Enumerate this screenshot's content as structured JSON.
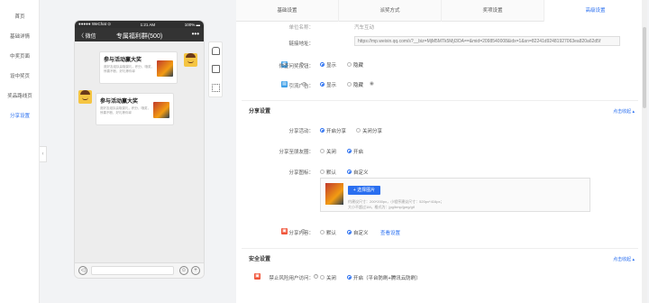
{
  "sidebar": {
    "items": [
      {
        "label": "首页"
      },
      {
        "label": "基础详情"
      },
      {
        "label": "中奖页面"
      },
      {
        "label": "设中奖页"
      },
      {
        "label": "奖品路线页"
      },
      {
        "label": "分享设置"
      }
    ]
  },
  "phone": {
    "carrier": "●●●●● WeChat ⊙",
    "time": "1:21 AM",
    "battery": "100% ▬",
    "back": "〈 微信",
    "title": "专属福利群(500)",
    "more": "•••",
    "messages": [
      {
        "title": "参与活动赢大奖",
        "desc": "邀好友组队赢取豪礼，积分、哦奖，惊喜不断，好礼等你拿"
      },
      {
        "title": "参与活动赢大奖",
        "desc": "邀好友组队赢取豪礼，积分，哦奖，惊喜不断，好礼等你拿"
      }
    ],
    "voice": "◁",
    "emoji": "☺",
    "plus": "+"
  },
  "tabs": [
    {
      "label": "基础设置"
    },
    {
      "label": "派奖方式"
    },
    {
      "label": "奖项设置"
    },
    {
      "label": "高级设置"
    }
  ],
  "form": {
    "top_label": "单位名称：",
    "top_value": "汽车互动",
    "link_label": "链接地址：",
    "link_value": "https://mp.weixin.qq.com/s?__biz=MjM5MTk5MjI3OA==&mid=2098540008&idx=1&sn=82241d92481927063ea820a62d5f",
    "show_label": "你查问奖按钮：",
    "show_opt1": "显示",
    "show_opt2": "隐藏",
    "ad_label": "引流广告：",
    "ad_opt1": "显示",
    "ad_opt2": "隐藏",
    "share_section": "分享设置",
    "collapse": "点击收起 ▴",
    "share_act_label": "分享活动：",
    "share_act_opt1": "开启分享",
    "share_act_opt2": "关闭分享",
    "share_friend_label": "分享至朋友圈：",
    "share_friend_opt1": "关闭",
    "share_friend_opt2": "开启",
    "share_img_label": "分享图标：",
    "share_img_opt1": "默认",
    "share_img_opt2": "自定义",
    "upload_btn": "+ 选择图片",
    "hint1": "约建议尺寸：200*200px，小程序建议尺寸：520px*416px；",
    "hint2": "大小不超过1M，格式为：jpg/bmp/jpeg/gif",
    "share_content_label": "分享内容：",
    "share_content_opt1": "默认",
    "share_content_opt2": "自定义",
    "share_content_link": "查看设置",
    "security_section": "安全设置",
    "security_collapse": "点击收起 ▴",
    "risk_label": "禁止风险用户访问：",
    "risk_opt1": "关闭",
    "risk_opt2": "开启（平台防刷+腾讯云防刷）"
  },
  "colors": {
    "accent": "#2a6ff0",
    "badge_blue": "#3fa0e8",
    "badge_red": "#f0553a"
  }
}
